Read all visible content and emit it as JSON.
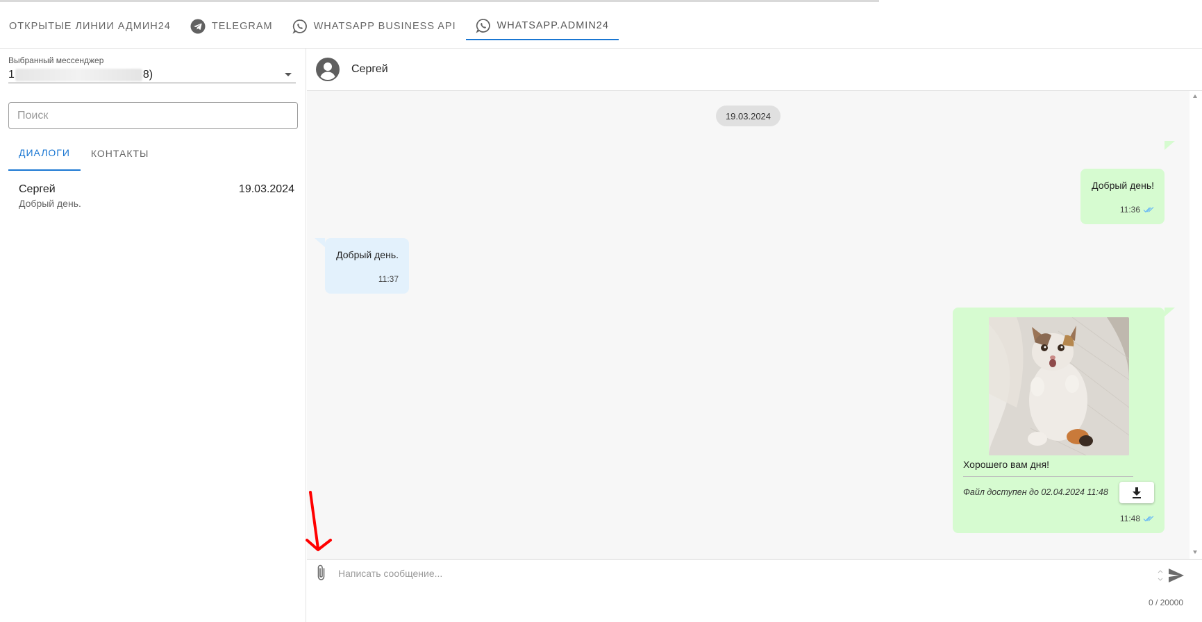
{
  "tabs": [
    {
      "label": "ОТКРЫТЫЕ ЛИНИИ АДМИН24",
      "icon": "",
      "active": false
    },
    {
      "label": "TELEGRAM",
      "icon": "telegram-icon",
      "active": false
    },
    {
      "label": "WHATSAPP BUSINESS API",
      "icon": "whatsapp-icon",
      "active": false
    },
    {
      "label": "WHATSAPP.ADMIN24",
      "icon": "whatsapp-icon",
      "active": true
    }
  ],
  "messenger_select": {
    "label": "Выбранный мессенджер",
    "value_start": "1",
    "value_end": "8)"
  },
  "search": {
    "placeholder": "Поиск"
  },
  "subtabs": {
    "dialogs": "ДИАЛОГИ",
    "contacts": "КОНТАКТЫ"
  },
  "dialog_list": [
    {
      "name": "Сергей",
      "date": "19.03.2024",
      "last_message": "Добрый день."
    }
  ],
  "chat": {
    "contact_name": "Сергей",
    "date_separator": "19.03.2024",
    "messages": [
      {
        "direction": "out",
        "text": "Добрый день!",
        "time": "11:36",
        "status": "read"
      },
      {
        "direction": "in",
        "text": "Добрый день.",
        "time": "11:37"
      },
      {
        "direction": "out",
        "type": "image",
        "caption": "Хорошего вам дня!",
        "file_note": "Файл доступен до 02.04.2024 11:48",
        "time": "11:48",
        "status": "read"
      }
    ]
  },
  "composer": {
    "placeholder": "Написать сообщение...",
    "counter": "0 / 20000"
  },
  "colors": {
    "accent": "#1976d2",
    "outgoing_bubble": "#d6fbd0",
    "incoming_bubble": "#e3f1fc",
    "read_check": "#64b5f6",
    "annotation_arrow": "#ff0000"
  }
}
